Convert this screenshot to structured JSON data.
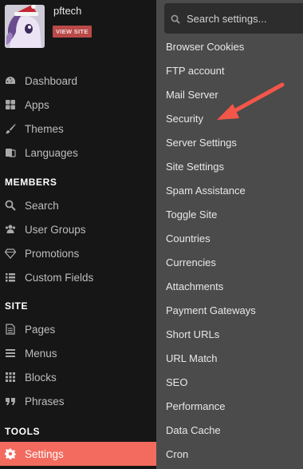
{
  "profile": {
    "username": "pftech",
    "view_site_label": "VIEW SITE"
  },
  "sidebar": {
    "main_items": [
      {
        "label": "Dashboard",
        "icon": "dashboard-icon"
      },
      {
        "label": "Apps",
        "icon": "apps-icon"
      },
      {
        "label": "Themes",
        "icon": "brush-icon"
      },
      {
        "label": "Languages",
        "icon": "language-icon"
      }
    ],
    "groups": [
      {
        "title": "MEMBERS",
        "items": [
          {
            "label": "Search",
            "icon": "search-icon"
          },
          {
            "label": "User Groups",
            "icon": "users-icon"
          },
          {
            "label": "Promotions",
            "icon": "diamond-icon"
          },
          {
            "label": "Custom Fields",
            "icon": "list-icon"
          }
        ]
      },
      {
        "title": "SITE",
        "items": [
          {
            "label": "Pages",
            "icon": "file-icon"
          },
          {
            "label": "Menus",
            "icon": "menu-icon"
          },
          {
            "label": "Blocks",
            "icon": "grid-icon"
          },
          {
            "label": "Phrases",
            "icon": "quote-icon"
          }
        ]
      },
      {
        "title": "TOOLS",
        "items": [
          {
            "label": "Settings",
            "icon": "gear-icon",
            "active": true
          }
        ]
      }
    ]
  },
  "settings_menu": {
    "search_placeholder": "Search settings...",
    "items": [
      "Browser Cookies",
      "FTP account",
      "Mail Server",
      "Security",
      "Server Settings",
      "Site Settings",
      "Spam Assistance",
      "Toggle Site",
      "Countries",
      "Currencies",
      "Attachments",
      "Payment Gateways",
      "Short URLs",
      "URL Match",
      "SEO",
      "Performance",
      "Data Cache",
      "Cron"
    ]
  },
  "colors": {
    "active_item": "#f36b5e",
    "arrow": "#f4564a",
    "view_site_badge": "#b94a48",
    "panel_bg": "#4b4b4b",
    "sidebar_bg": "#161616"
  }
}
